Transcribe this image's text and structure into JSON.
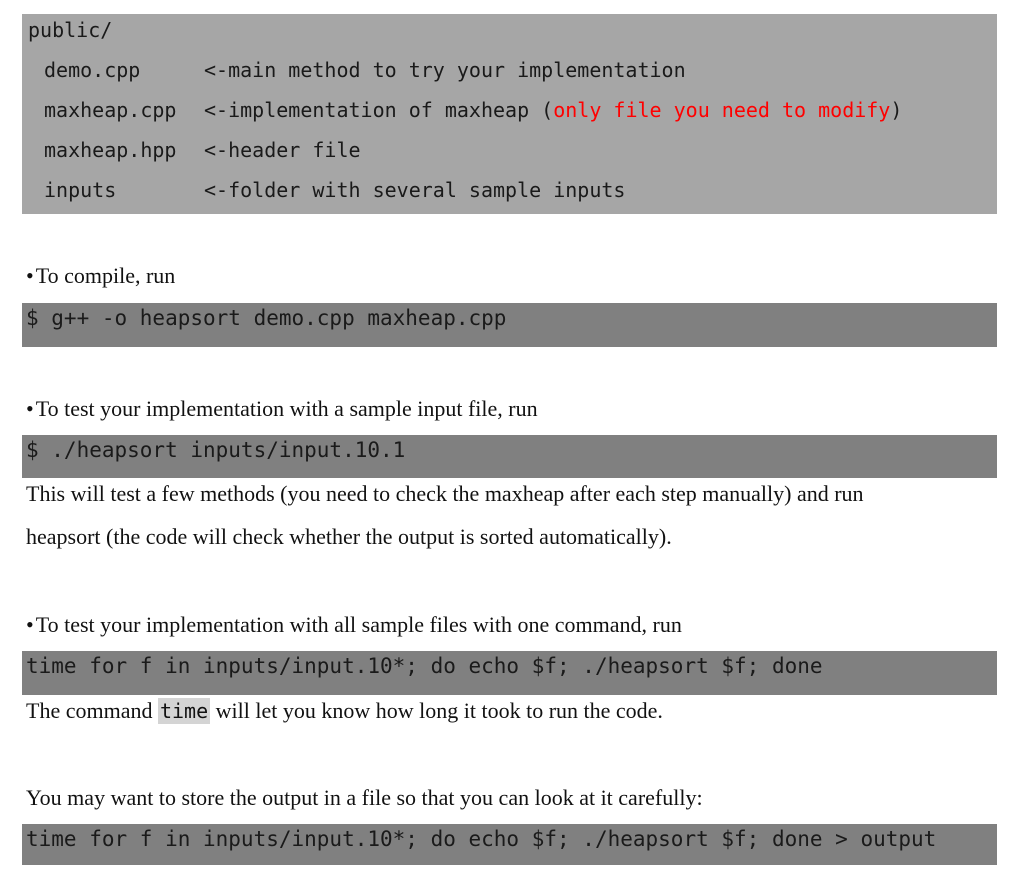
{
  "listing": {
    "dir": "public/",
    "rows": [
      {
        "name": "demo.cpp",
        "desc": "<-main method to try your implementation"
      },
      {
        "name": "maxheap.cpp",
        "desc": "<-implementation of maxheap (",
        "desc_red": "only file you need to modify",
        "desc_end": ")"
      },
      {
        "name": "maxheap.hpp",
        "desc": "<-header file"
      },
      {
        "name": "inputs",
        "desc": "<-folder with several sample inputs"
      }
    ]
  },
  "compile": {
    "bullet": "•",
    "text": "To compile, run",
    "command": "$ g++ -o heapsort demo.cpp maxheap.cpp"
  },
  "test_single": {
    "bullet": "•",
    "text": "To test your implementation with a sample input file, run",
    "command": "$ ./heapsort inputs/input.10.1",
    "note_line1": "This will test a few methods (you need to check the maxheap after each step manually) and run",
    "note_line2": "heapsort (the code will check whether the output is sorted automatically)."
  },
  "test_all": {
    "bullet": "•",
    "text": "To test your implementation with all sample files with one command, run",
    "command": "time for f in inputs/input.10*; do echo $f; ./heapsort $f; done",
    "note_pre": "The command ",
    "note_code": "time",
    "note_post": " will let you know how long it took to run the code."
  },
  "store_output": {
    "text": "You may want to store the output in a file so that you can look at it carefully:",
    "command": "time for f in inputs/input.10*; do echo $f; ./heapsort $f; done > output"
  },
  "colors": {
    "listing_bg": "#a6a6a6",
    "command_bg": "#808080",
    "highlight_red": "#ff0000",
    "inline_code_bg": "#d4d4d4"
  }
}
